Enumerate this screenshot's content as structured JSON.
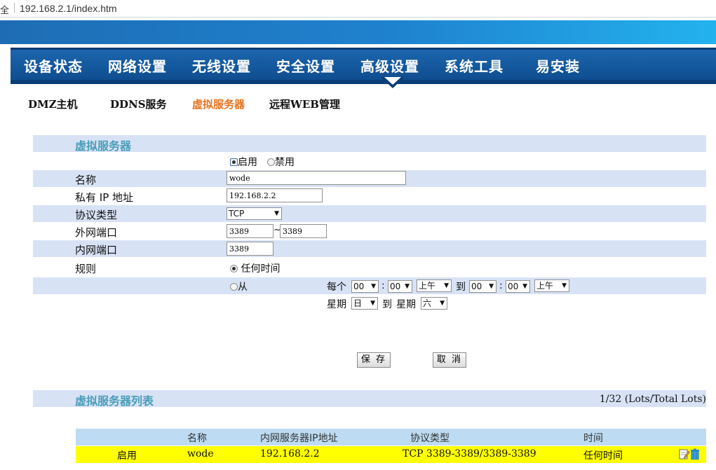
{
  "browser": {
    "security": "全",
    "url": "192.168.2.1/index.htm"
  },
  "nav": [
    "设备状态",
    "网络设置",
    "无线设置",
    "安全设置",
    "高级设置",
    "系统工具",
    "易安装"
  ],
  "subnav": [
    "DMZ主机",
    "DDNS服务",
    "虚拟服务器",
    "远程WEB管理"
  ],
  "form": {
    "title": "虚拟服务器",
    "enable_label": "启用",
    "disable_label": "禁用",
    "name_label": "名称",
    "name_value": "wode",
    "ip_label": "私有 IP 地址",
    "ip_value": "192.168.2.2",
    "protocol_label": "协议类型",
    "protocol_value": "TCP",
    "ext_port_label": "外网端口",
    "ext_port_from": "3389",
    "ext_port_sep": "~",
    "ext_port_to": "3389",
    "int_port_label": "内网端口",
    "int_port_value": "3389",
    "rule_label": "规则",
    "anytime_label": "任何时间",
    "from_label": "从",
    "every_label": "每个",
    "start_hour": "00",
    "colon": ":",
    "start_min": "00",
    "start_ampm": "上午",
    "to_label": "到",
    "end_hour": "00",
    "end_min": "00",
    "end_ampm": "上午",
    "week_label": "星期",
    "week_start": "日",
    "week_end": "六",
    "save_label": "保 存",
    "cancel_label": "取 消"
  },
  "list": {
    "title": "虚拟服务器列表",
    "pager": "1/32 (Lots/Total Lots)",
    "headers": [
      "名称",
      "内网服务器IP地址",
      "协议类型",
      "时间"
    ],
    "rows": [
      {
        "status": "启用",
        "name": "wode",
        "ip": "192.168.2.2",
        "protocol": "TCP 3389-3389/3389-3389",
        "time": "任何时间"
      }
    ]
  }
}
